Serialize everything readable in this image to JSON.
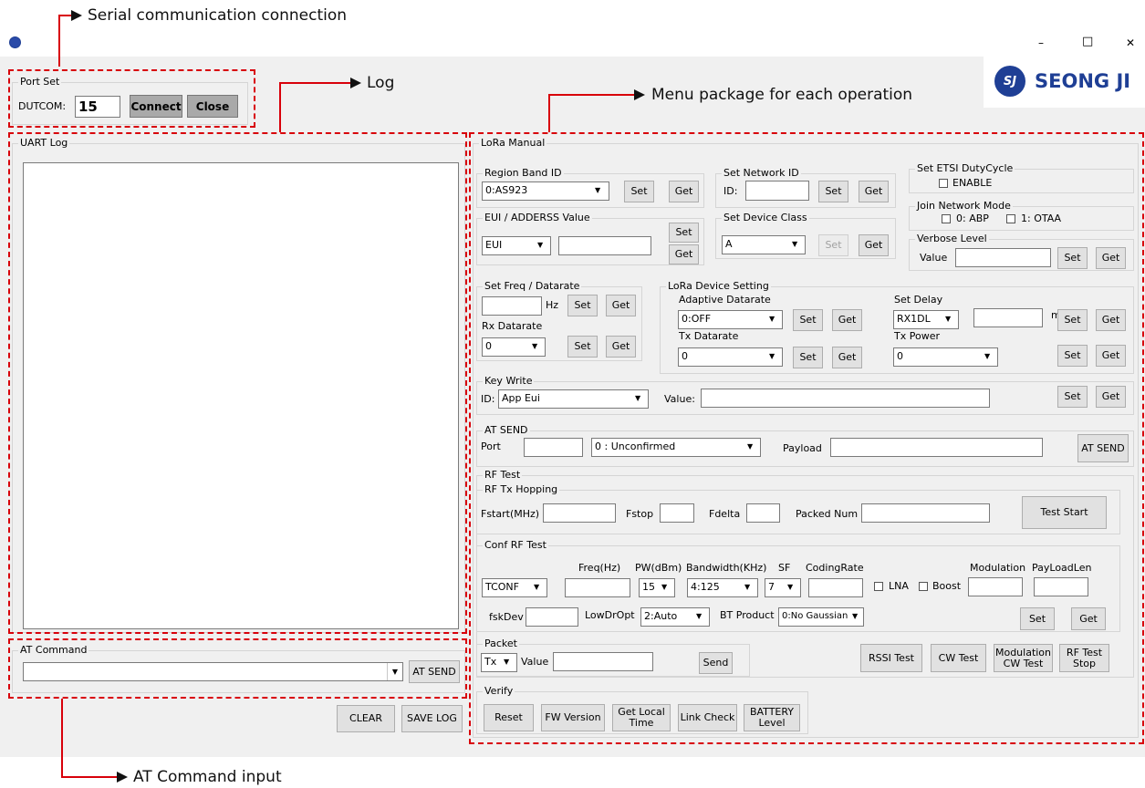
{
  "annotations": {
    "serial": "Serial communication connection",
    "log": "Log",
    "menu": "Menu package for each operation",
    "at_input": "AT Command input"
  },
  "window": {
    "app_icon": "app-logo-icon",
    "minimize": "–",
    "maximize": "□",
    "close": "✕",
    "brand": "SEONG JI",
    "brand_mark": "SJ",
    "brand_color": "#1f3f95",
    "accent_color": "#d8000a"
  },
  "port_set": {
    "title": "Port Set",
    "dutcom_label": "DUTCOM:",
    "dutcom_value": "15",
    "connect": "Connect",
    "close": "Close"
  },
  "uart_log": {
    "title": "UART Log"
  },
  "at_command": {
    "title": "AT Command",
    "send": "AT SEND"
  },
  "log_buttons": {
    "clear": "CLEAR",
    "save": "SAVE LOG"
  },
  "lora": {
    "title": "LoRa Manual",
    "set": "Set",
    "get": "Get",
    "region": {
      "title": "Region Band ID",
      "value": "0:AS923"
    },
    "network": {
      "title": "Set Network ID",
      "id_label": "ID:"
    },
    "etsi": {
      "title": "Set ETSI DutyCycle",
      "enable": "ENABLE"
    },
    "join": {
      "title": "Join Network Mode",
      "abp": "0: ABP",
      "otaa": "1: OTAA"
    },
    "eui": {
      "title": "EUI / ADDERSS Value",
      "type": "EUI"
    },
    "device_class": {
      "title": "Set Device Class",
      "value": "A"
    },
    "verbose": {
      "title": "Verbose Level",
      "value_label": "Value"
    },
    "freq": {
      "title": "Set Freq / Datarate",
      "hz": "Hz",
      "rx_label": "Rx Datarate",
      "rx_value": "0"
    },
    "device_setting": {
      "title": "LoRa Device Setting",
      "adaptive_label": "Adaptive Datarate",
      "adaptive_value": "0:OFF",
      "tx_dr_label": "Tx Datarate",
      "tx_dr_value": "0",
      "delay_label": "Set Delay",
      "delay_value": "RX1DL",
      "ms": "ms",
      "tx_power_label": "Tx Power",
      "tx_power_value": "0"
    },
    "key_write": {
      "title": "Key Write",
      "id_label": "ID:",
      "id_value": "App Eui",
      "value_label": "Value:"
    },
    "at_send": {
      "title": "AT SEND",
      "port_label": "Port",
      "mode": "0 : Unconfirmed",
      "payload_label": "Payload",
      "button": "AT SEND"
    },
    "rf_test": {
      "title": "RF Test",
      "hopping": {
        "title": "RF Tx Hopping",
        "fstart": "Fstart(MHz)",
        "fstop": "Fstop",
        "fdelta": "Fdelta",
        "packed": "Packed Num",
        "start": "Test Start"
      },
      "conf": {
        "title": "Conf RF Test",
        "freq": "Freq(Hz)",
        "pw": "PW(dBm)",
        "bandwidth": "Bandwidth(KHz)",
        "sf": "SF",
        "coding": "CodingRate",
        "modulation": "Modulation",
        "payload_len": "PayLoadLen",
        "mode_value": "TCONF",
        "pw_value": "15",
        "bw_value": "4:125",
        "sf_value": "7",
        "lna": "LNA",
        "boost": "Boost",
        "fskdev": "fskDev",
        "lowdr": "LowDrOpt",
        "lowdr_value": "2:Auto",
        "bt": "BT Product",
        "bt_value": "0:No Gaussian"
      },
      "packet": {
        "title": "Packet",
        "mode": "Tx",
        "value_label": "Value",
        "send": "Send"
      },
      "rssi": "RSSI Test",
      "cw": "CW Test",
      "mod_cw": "Modulation CW Test",
      "stop": "RF Test Stop"
    },
    "verify": {
      "title": "Verify",
      "reset": "Reset",
      "fw": "FW Version",
      "local_time": "Get Local Time",
      "link": "Link Check",
      "battery": "BATTERY Level"
    }
  }
}
